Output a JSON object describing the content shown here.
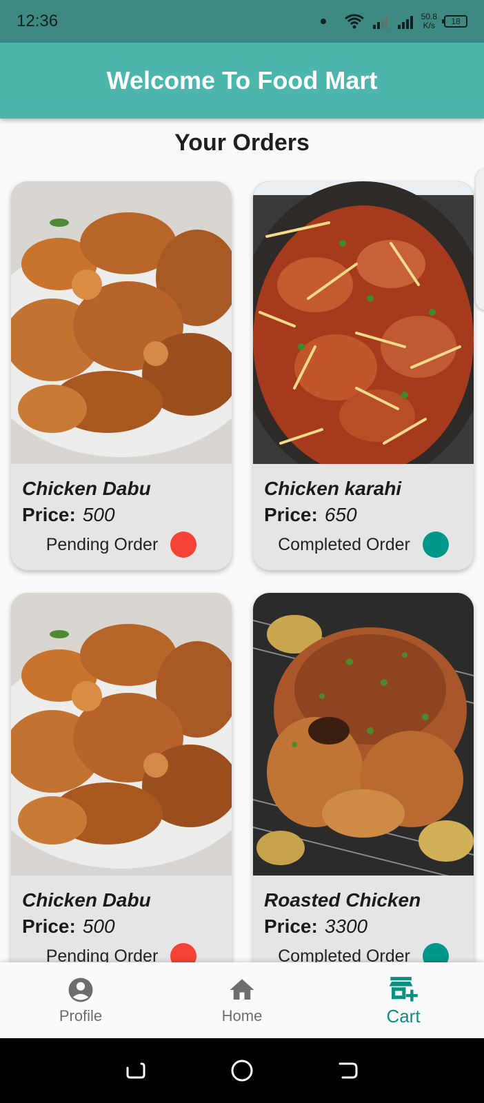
{
  "status_bar": {
    "time": "12:36",
    "speed_value": "50.8",
    "speed_unit": "K/s",
    "battery": "18"
  },
  "app_bar": {
    "title": "Welcome To Food Mart"
  },
  "page": {
    "section_title": "Your Orders"
  },
  "orders": [
    {
      "name": "Chicken Dabu",
      "price_label": "Price:",
      "price": "500",
      "status": "Pending Order",
      "status_color": "#f44336",
      "image": "fried-chicken"
    },
    {
      "name": "Chicken karahi",
      "price_label": "Price:",
      "price": "650",
      "status": "Completed Order",
      "status_color": "#009688",
      "image": "chicken-karahi"
    },
    {
      "name": "Chicken Dabu",
      "price_label": "Price:",
      "price": "500",
      "status": "Pending Order",
      "status_color": "#f44336",
      "image": "fried-chicken"
    },
    {
      "name": "Roasted Chicken",
      "price_label": "Price:",
      "price": "3300",
      "status": "Completed Order",
      "status_color": "#009688",
      "image": "roasted-chicken"
    }
  ],
  "bottom_nav": [
    {
      "label": "Profile",
      "icon": "account-circle-icon"
    },
    {
      "label": "Home",
      "icon": "home-icon"
    },
    {
      "label": "Cart",
      "icon": "store-add-icon",
      "active": true
    }
  ],
  "colors": {
    "primary": "#4db6ac",
    "status_bar": "#3e8a82",
    "accent": "#0b8f80",
    "pending": "#f44336",
    "completed": "#009688"
  }
}
